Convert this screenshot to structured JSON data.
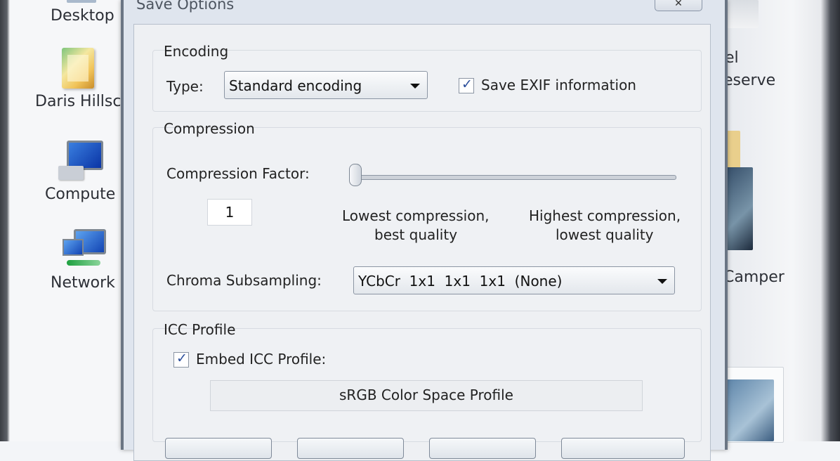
{
  "desktop": {
    "left_icons": [
      {
        "label": "Desktop"
      },
      {
        "label": "Daris Hillsc"
      },
      {
        "label": "Compute"
      },
      {
        "label": "Network"
      }
    ],
    "right_labels": [
      {
        "label": "el"
      },
      {
        "label": "eserve"
      },
      {
        "label": "Camper"
      }
    ]
  },
  "dialog": {
    "title": "Save Options",
    "close_label": "✕",
    "encoding": {
      "group_label": "Encoding",
      "type_label": "Type:",
      "type_value": "Standard encoding",
      "exif_checked": true,
      "exif_label": "Save EXIF information"
    },
    "compression": {
      "group_label": "Compression",
      "factor_label": "Compression Factor:",
      "factor_value": "1",
      "slider_fraction": 0.0,
      "low_caption_line1": "Lowest compression,",
      "low_caption_line2": "best quality",
      "high_caption_line1": "Highest compression,",
      "high_caption_line2": "lowest quality",
      "chroma_label": "Chroma Subsampling:",
      "chroma_value": "YCbCr  1x1  1x1  1x1  (None)"
    },
    "icc": {
      "group_label": "ICC Profile",
      "embed_checked": true,
      "embed_label": "Embed ICC Profile:",
      "profile_name": "sRGB Color Space Profile"
    }
  }
}
